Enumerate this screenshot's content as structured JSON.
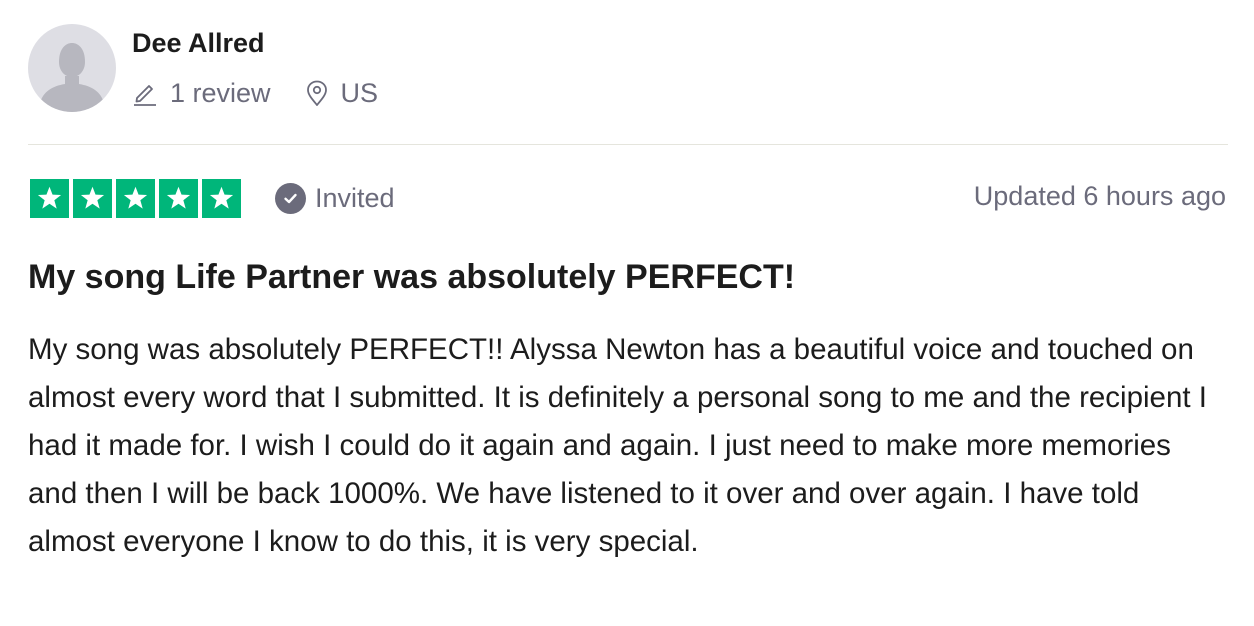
{
  "author": {
    "name": "Dee Allred",
    "avatar_icon": "user-silhouette-icon",
    "review_count": "1 review",
    "review_count_icon": "pencil-icon",
    "country": "US",
    "country_icon": "location-pin-icon"
  },
  "rating": {
    "stars": 5,
    "max_stars": 5,
    "star_color": "#00b67a",
    "star_icon": "star-icon"
  },
  "invited": {
    "label": "Invited",
    "icon": "check-circle-icon"
  },
  "date_text": "Updated 6 hours ago",
  "review": {
    "title": "My song Life Partner was absolutely PERFECT!",
    "body": "My song was absolutely PERFECT!! Alyssa Newton has a beautiful voice and touched on almost every word that I submitted. It is definitely a personal song to me and the recipient I had it made for. I wish I could do it again and again. I just need to make more memories and then I will be back 1000%. We have listened to it over and over again. I have told almost everyone I know to do this, it is very special."
  },
  "colors": {
    "text_primary": "#1c1c1c",
    "text_secondary": "#6b6b7b",
    "divider": "#e5e5dd",
    "avatar_bg": "#dedee4",
    "avatar_figure": "#b7b7bf"
  }
}
